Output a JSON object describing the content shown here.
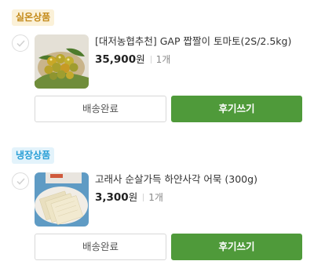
{
  "sections": [
    {
      "label": "실온상품",
      "badge_color": "#c48a1a",
      "item": {
        "name": "[대저농협추천] GAP 짭짤이 토마토(2S/2.5kg)",
        "price": "35,900",
        "currency": "원",
        "quantity": "1개",
        "thumbnail_icon": "tomato-product-image"
      },
      "buttons": {
        "status": "배송완료",
        "review": "후기쓰기"
      }
    },
    {
      "label": "냉장상품",
      "badge_color": "#2a9fd6",
      "item": {
        "name": "고래사 순살가득 하얀사각 어묵 (300g)",
        "price": "3,300",
        "currency": "원",
        "quantity": "1개",
        "thumbnail_icon": "fishcake-product-image"
      },
      "buttons": {
        "status": "배송완료",
        "review": "후기쓰기"
      }
    }
  ],
  "colors": {
    "accent": "#4f9a3a"
  }
}
